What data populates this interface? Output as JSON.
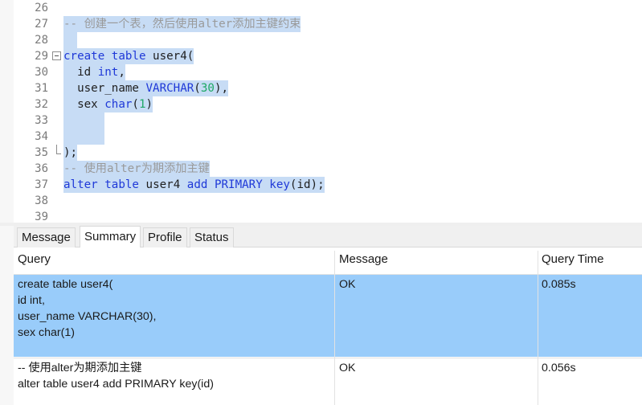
{
  "editor": {
    "lines": [
      {
        "num": "26",
        "segments": []
      },
      {
        "num": "27",
        "selected": true,
        "segments": [
          {
            "t": "-- 创建一个表，然后使用alter添加主键约束",
            "c": "cm"
          }
        ]
      },
      {
        "num": "28",
        "selected": true,
        "segments": [
          {
            "t": "  ",
            "c": "fn"
          }
        ]
      },
      {
        "num": "29",
        "selected": true,
        "fold": "start",
        "segments": [
          {
            "t": "create",
            "c": "kw"
          },
          {
            "t": " ",
            "c": "fn"
          },
          {
            "t": "table",
            "c": "kw"
          },
          {
            "t": " user4(",
            "c": "fn"
          }
        ]
      },
      {
        "num": "30",
        "selected": true,
        "segments": [
          {
            "t": "  id ",
            "c": "fn"
          },
          {
            "t": "int",
            "c": "kw"
          },
          {
            "t": ",",
            "c": "fn"
          }
        ]
      },
      {
        "num": "31",
        "selected": true,
        "segments": [
          {
            "t": "  user_name ",
            "c": "fn"
          },
          {
            "t": "VARCHAR",
            "c": "kw"
          },
          {
            "t": "(",
            "c": "fn"
          },
          {
            "t": "30",
            "c": "num"
          },
          {
            "t": "),",
            "c": "fn"
          }
        ]
      },
      {
        "num": "32",
        "selected": true,
        "segments": [
          {
            "t": "  sex ",
            "c": "fn"
          },
          {
            "t": "char",
            "c": "kw"
          },
          {
            "t": "(",
            "c": "fn"
          },
          {
            "t": "1",
            "c": "num"
          },
          {
            "t": ")",
            "c": "fn"
          }
        ]
      },
      {
        "num": "33",
        "selected": true,
        "segments": [
          {
            "t": "      ",
            "c": "fn"
          }
        ]
      },
      {
        "num": "34",
        "selected": true,
        "segments": [
          {
            "t": "      ",
            "c": "fn"
          }
        ]
      },
      {
        "num": "35",
        "selected": true,
        "fold": "end",
        "segments": [
          {
            "t": ");",
            "c": "fn"
          }
        ]
      },
      {
        "num": "36",
        "selected": true,
        "segments": [
          {
            "t": "-- 使用alter为期添加主键",
            "c": "cm"
          }
        ]
      },
      {
        "num": "37",
        "selected": true,
        "segments": [
          {
            "t": "alter",
            "c": "kw"
          },
          {
            "t": " ",
            "c": "fn"
          },
          {
            "t": "table",
            "c": "kw"
          },
          {
            "t": " user4 ",
            "c": "fn"
          },
          {
            "t": "add",
            "c": "kw"
          },
          {
            "t": " ",
            "c": "fn"
          },
          {
            "t": "PRIMARY",
            "c": "kw"
          },
          {
            "t": " ",
            "c": "fn"
          },
          {
            "t": "key",
            "c": "kw"
          },
          {
            "t": "(id);",
            "c": "fn"
          }
        ]
      },
      {
        "num": "38",
        "segments": []
      },
      {
        "num": "39",
        "segments": []
      }
    ]
  },
  "tabs": [
    {
      "label": "Message",
      "active": false
    },
    {
      "label": "Summary",
      "active": true
    },
    {
      "label": "Profile",
      "active": false
    },
    {
      "label": "Status",
      "active": false
    }
  ],
  "results": {
    "headers": {
      "query": "Query",
      "message": "Message",
      "time": "Query Time"
    },
    "rows": [
      {
        "query": "create table user4(\nid int,\nuser_name VARCHAR(30),\nsex char(1)",
        "message": "OK",
        "time": "0.085s",
        "selected": true
      },
      {
        "query": "-- 使用alter为期添加主键\nalter table user4 add PRIMARY key(id)",
        "message": "OK",
        "time": "0.056s",
        "selected": false
      }
    ]
  }
}
